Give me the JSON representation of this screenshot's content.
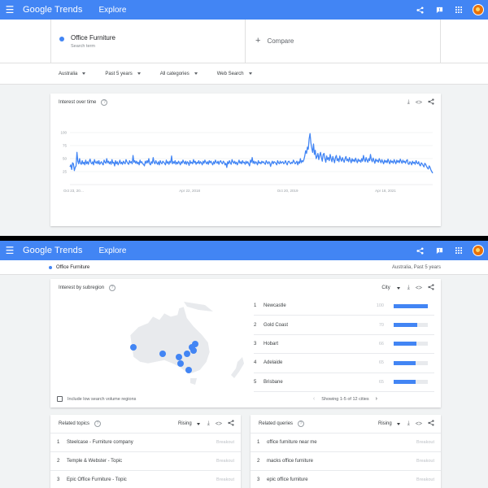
{
  "app": {
    "logo_google": "Google",
    "logo_trends": "Trends",
    "page": "Explore"
  },
  "search": {
    "term": "Office Furniture",
    "term_type": "Search term",
    "compare": "Compare"
  },
  "filters": {
    "region": "Australia",
    "period": "Past 5 years",
    "category": "All categories",
    "property": "Web Search"
  },
  "interest_over_time": {
    "title": "Interest over time",
    "y_ticks": [
      "100",
      "75",
      "50",
      "25"
    ],
    "x_ticks": [
      "Oct 23, 20…",
      "Apr 22, 2018",
      "Oct 20, 2019",
      "Apr 18, 2021"
    ]
  },
  "chart_data": {
    "type": "line",
    "title": "Interest over time",
    "ylim": [
      0,
      100
    ],
    "x_labels": [
      "Oct 23, 20…",
      "Apr 22, 2018",
      "Oct 20, 2019",
      "Apr 18, 2021"
    ],
    "grid": true,
    "legend": "none",
    "series": [
      {
        "color": "#4285f4",
        "values": [
          34,
          38,
          29,
          42,
          40,
          27,
          33,
          36,
          62,
          45,
          40,
          50,
          41,
          39,
          46,
          40,
          43,
          38,
          47,
          40,
          44,
          39,
          45,
          49,
          42,
          40,
          44,
          38,
          48,
          43,
          41,
          45,
          40,
          46,
          39,
          42,
          44,
          40,
          38,
          47,
          43,
          41,
          50,
          42,
          45,
          40,
          44,
          39,
          48,
          41,
          43,
          36,
          46,
          40,
          44,
          38,
          42,
          47,
          40,
          43,
          39,
          45,
          42,
          40,
          48,
          44,
          41,
          39,
          46,
          42,
          44,
          40,
          56,
          43,
          46,
          41,
          45,
          40,
          43,
          38,
          47,
          42,
          44,
          40,
          39,
          36,
          45,
          41,
          46,
          42,
          50,
          40,
          38,
          44,
          41,
          52,
          43,
          40,
          46,
          42,
          39,
          44,
          38,
          46,
          42,
          40,
          45,
          43,
          41,
          38,
          47,
          41,
          44,
          39,
          45,
          42,
          55,
          40,
          44,
          41,
          46,
          39,
          43,
          40,
          45,
          42,
          38,
          44,
          41,
          47,
          43,
          40,
          45,
          39,
          44,
          42,
          37,
          46,
          41,
          43,
          40,
          48,
          42,
          45,
          39,
          43,
          41,
          46,
          40,
          44,
          42,
          38,
          45,
          41,
          47,
          43,
          40,
          44,
          39,
          46,
          42,
          45,
          41,
          38,
          44,
          40,
          47,
          43,
          41,
          45,
          39,
          44,
          46,
          42,
          40,
          45,
          43,
          38,
          41,
          33,
          44,
          40,
          46,
          42,
          39,
          48,
          44,
          41,
          45,
          40,
          43,
          38,
          42,
          47,
          41,
          44,
          40,
          46,
          42,
          43,
          39,
          45,
          41,
          44,
          40,
          36,
          47,
          43,
          52,
          41,
          45,
          40,
          44,
          42,
          38,
          46,
          41,
          43,
          40,
          45,
          42,
          44,
          41,
          39,
          46,
          43,
          40,
          44,
          42,
          35,
          41,
          45,
          40,
          44,
          43,
          41,
          38,
          46,
          42,
          40,
          45,
          41,
          43,
          44,
          40,
          42,
          46,
          41,
          38,
          44,
          45,
          42,
          40,
          43,
          41,
          47,
          44,
          40,
          42,
          45,
          38,
          44,
          41,
          50,
          42,
          46,
          44,
          48,
          55,
          65,
          60,
          72,
          68,
          88,
          98,
          80,
          70,
          62,
          78,
          58,
          66,
          50,
          54,
          60,
          48,
          56,
          62,
          52,
          45,
          58,
          60,
          50,
          43,
          55,
          48,
          52,
          46,
          58,
          50,
          44,
          54,
          48,
          42,
          52,
          56,
          46,
          50,
          44,
          55,
          49,
          45,
          52,
          47,
          43,
          50,
          54,
          46,
          49,
          44,
          52,
          47,
          42,
          50,
          45,
          48,
          44,
          51,
          46,
          42,
          49,
          45,
          47,
          43,
          50,
          45,
          56,
          48,
          44,
          52,
          47,
          43,
          50,
          46,
          58,
          48,
          44,
          51,
          46,
          41,
          49,
          45,
          47,
          43,
          50,
          46,
          42,
          48,
          44,
          40,
          47,
          43,
          46,
          42,
          49,
          44,
          40,
          47,
          43,
          45,
          41,
          48,
          44,
          40,
          47,
          43,
          46,
          42,
          49,
          45,
          41,
          47,
          43,
          45,
          41,
          46,
          48,
          40,
          39,
          44,
          42,
          38,
          45,
          41,
          43,
          39,
          46,
          42,
          40,
          44,
          38,
          36,
          42,
          40,
          37,
          34,
          41,
          39,
          35,
          32,
          30,
          36,
          33,
          28,
          25,
          22
        ]
      }
    ]
  },
  "frame2_header": {
    "term": "Office Furniture",
    "meta": "Australia, Past 5 years"
  },
  "subregion": {
    "title": "Interest by subregion",
    "resolution": "City",
    "rows": [
      {
        "rank": "1",
        "name": "Newcastle",
        "value": "100",
        "pct": 100
      },
      {
        "rank": "2",
        "name": "Gold Coast",
        "value": "70",
        "pct": 70
      },
      {
        "rank": "3",
        "name": "Hobart",
        "value": "66",
        "pct": 66
      },
      {
        "rank": "4",
        "name": "Adelaide",
        "value": "65",
        "pct": 65
      },
      {
        "rank": "5",
        "name": "Brisbane",
        "value": "65",
        "pct": 65
      }
    ],
    "low_volume": "Include low search volume regions",
    "pager": "Showing 1-5 of 12 cities"
  },
  "related_topics": {
    "title": "Related topics",
    "mode": "Rising",
    "rows": [
      {
        "rank": "1",
        "label": "Steelcase - Furniture company",
        "value": "Breakout"
      },
      {
        "rank": "2",
        "label": "Temple & Webster - Topic",
        "value": "Breakout"
      },
      {
        "rank": "3",
        "label": "Epic Office Furniture - Topic",
        "value": "Breakout"
      }
    ]
  },
  "related_queries": {
    "title": "Related queries",
    "mode": "Rising",
    "rows": [
      {
        "rank": "1",
        "label": "office furniture near me",
        "value": "Breakout"
      },
      {
        "rank": "2",
        "label": "macks office furniture",
        "value": "Breakout"
      },
      {
        "rank": "3",
        "label": "epic office furniture",
        "value": "Breakout"
      }
    ]
  },
  "colors": {
    "brand": "#4285f4",
    "line": "#4285f4"
  }
}
